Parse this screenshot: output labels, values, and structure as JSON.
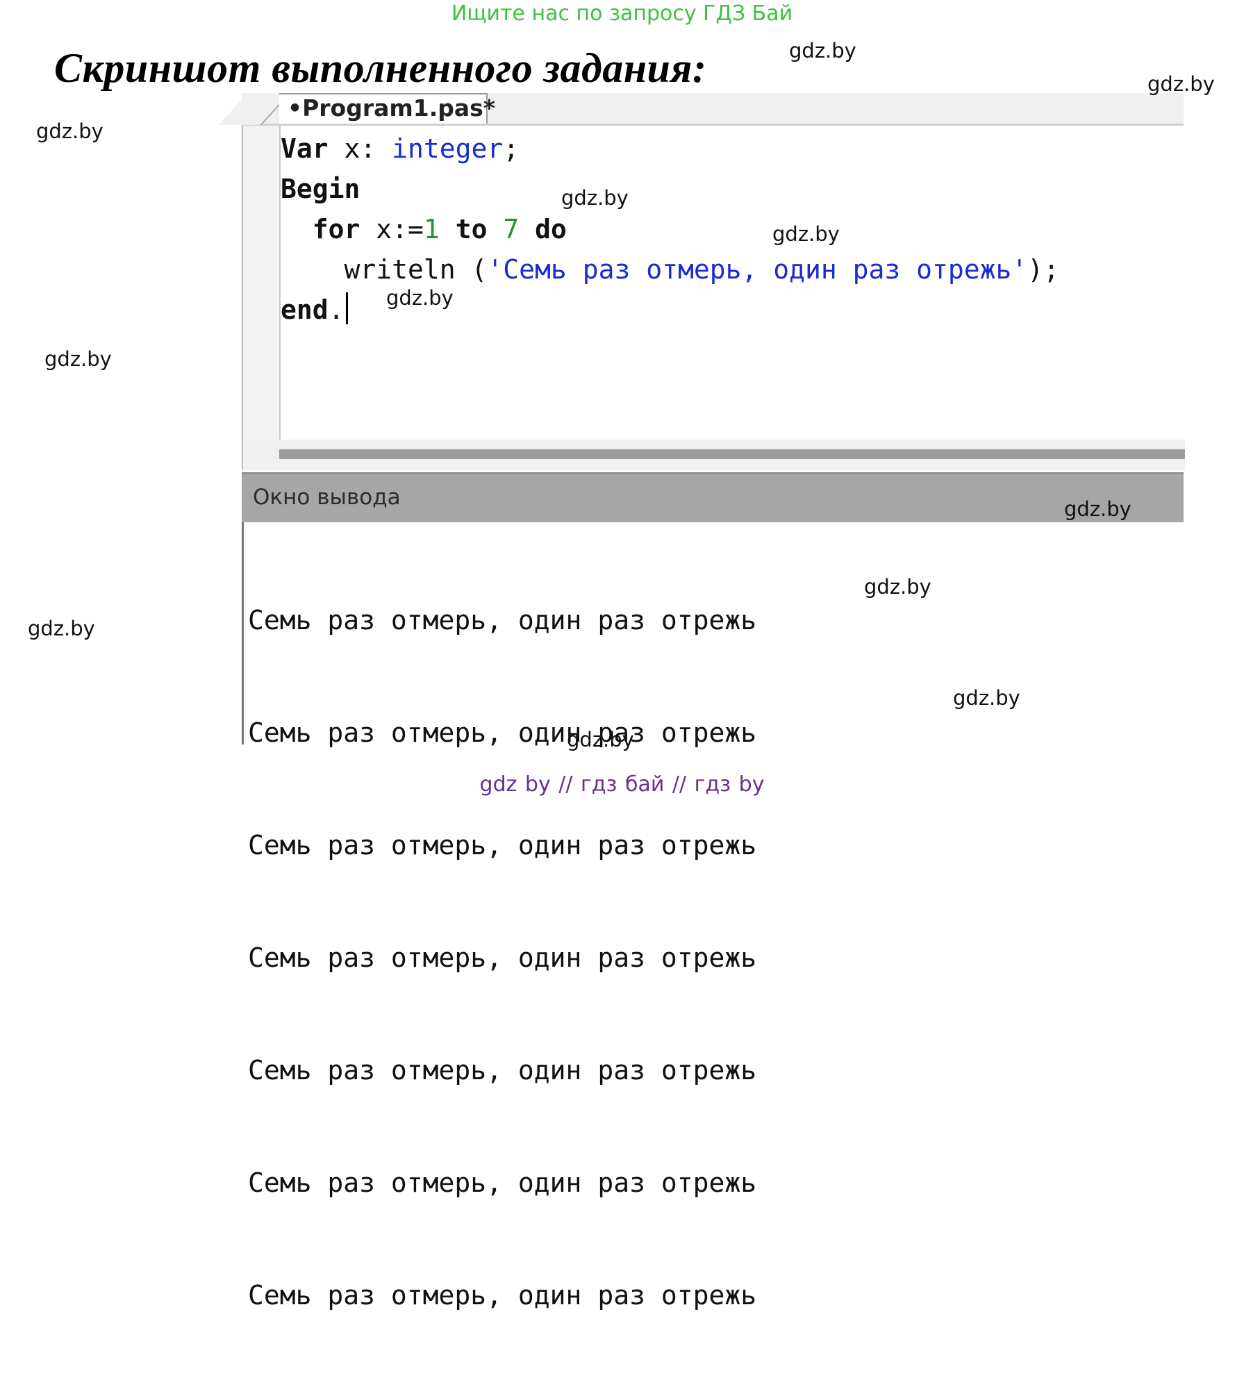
{
  "banner": "Ищите нас по запросу ГДЗ Бай",
  "heading": "Скриншот выполненного задания:",
  "tab": {
    "label": "•Program1.pas*"
  },
  "code": {
    "line1": {
      "kw": "Var",
      "ident": " x: ",
      "type": "integer",
      "end": ";"
    },
    "line2": {
      "kw": "Begin"
    },
    "line3": {
      "indent": "  ",
      "kw1": "for",
      "mid1": " x:=",
      "num1": "1",
      "sp": " ",
      "kw2": "to",
      "sp2": " ",
      "num2": "7",
      "sp3": " ",
      "kw3": "do"
    },
    "line4": {
      "indent": "    ",
      "fn": "writeln (",
      "str": "'Семь раз отмерь, один раз отрежь'",
      "end": ");"
    },
    "line5": {
      "kw": "end",
      "end": "."
    }
  },
  "output": {
    "title": "Окно вывода",
    "lines": [
      "Семь раз отмерь, один раз отрежь",
      "Семь раз отмерь, один раз отрежь",
      "Семь раз отмерь, один раз отрежь",
      "Семь раз отмерь, один раз отрежь",
      "Семь раз отмерь, один раз отрежь",
      "Семь раз отмерь, один раз отрежь",
      "Семь раз отмерь, один раз отрежь"
    ]
  },
  "watermark": "gdz.by",
  "footer": "gdz by  //  гдз бай  //  гдз by"
}
